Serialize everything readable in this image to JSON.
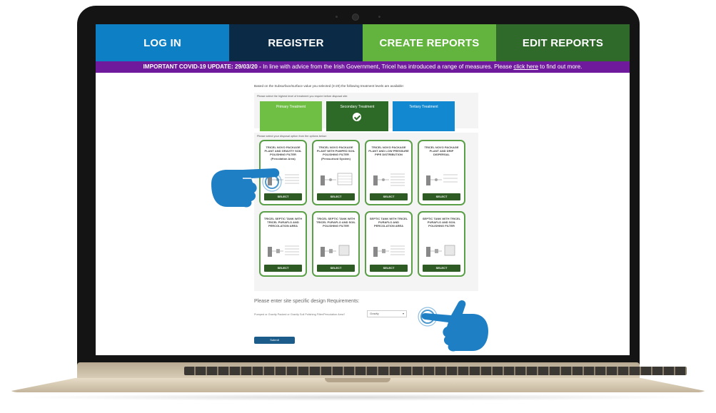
{
  "nav": {
    "login": "LOG IN",
    "register": "REGISTER",
    "create_reports": "CREATE REPORTS",
    "edit_reports": "EDIT REPORTS"
  },
  "covid": {
    "headline": "IMPORTANT COVID-19 UPDATE: 29/03/20 -",
    "text": " In line with advice from the Irish Government, Tricel has introduced a range of measures. Please ",
    "link": "click here",
    "tail": " to find out more."
  },
  "form": {
    "intro": "Based on the Subsurface/surface value you selected (3-20) the following treatment levels are available:",
    "level_hint": "Please select the highest level of treatment you require before disposal site:",
    "levels": [
      {
        "label": "Primary Treatment",
        "selected": false
      },
      {
        "label": "Secondary Treatment",
        "selected": true
      },
      {
        "label": "Tertiary Treatment",
        "selected": false
      }
    ],
    "options_hint": "Please select your disposal option from the options below:",
    "options": [
      {
        "title": "TRICEL NOVO PACKAGE PLANT AND GRAVITY SOIL POLISHING FILTER (Percolation Area)",
        "button": "SELECT"
      },
      {
        "title": "TRICEL NOVO PACKAGE PLANT WITH PUMPED SOIL POLISHING FILTER (Pressurised System)",
        "button": "SELECT"
      },
      {
        "title": "TRICEL NOVO PACKAGE PLANT AND LOW PRESSURE PIPE DISTRIBUTION",
        "button": "SELECT"
      },
      {
        "title": "TRICEL NOVO PACKAGE PLANT AND DRIP DISPERSAL",
        "button": "SELECT"
      },
      {
        "title": "TRICEL SEPTIC TANK WITH TRICEL PURAFLO AND PERCOLATION AREA",
        "button": "SELECT"
      },
      {
        "title": "TRICEL SEPTIC TANK WITH TRICEL PURAFLO AND SOIL POLISHING FILTER",
        "button": "SELECT"
      },
      {
        "title": "SEPTIC TANK WITH TRICEL PURAFLO AND PERCOLATION AREA",
        "button": "SELECT"
      },
      {
        "title": "SEPTIC TANK WITH TRICEL PURAFLO AND SOIL POLISHING FILTER",
        "button": "SELECT"
      }
    ],
    "requirements_title": "Please enter site specific design Requirements:",
    "requirements_label": "Pumped or Gravity Packed or Gravity Soil Polishing Filter/Percolation Area?",
    "requirements_value": "Gravity",
    "submit": "Submit"
  },
  "colors": {
    "login": "#0d7fc4",
    "register": "#0b2a45",
    "create_reports": "#62b43f",
    "edit_reports": "#2f6a2b",
    "covid_banner": "#6f1a9c",
    "card_border": "#5ba048",
    "hand": "#1f7fc4"
  },
  "icons": [
    "pointing-hand-icon",
    "pointing-hand-icon",
    "check-icon",
    "caret-down-icon"
  ]
}
